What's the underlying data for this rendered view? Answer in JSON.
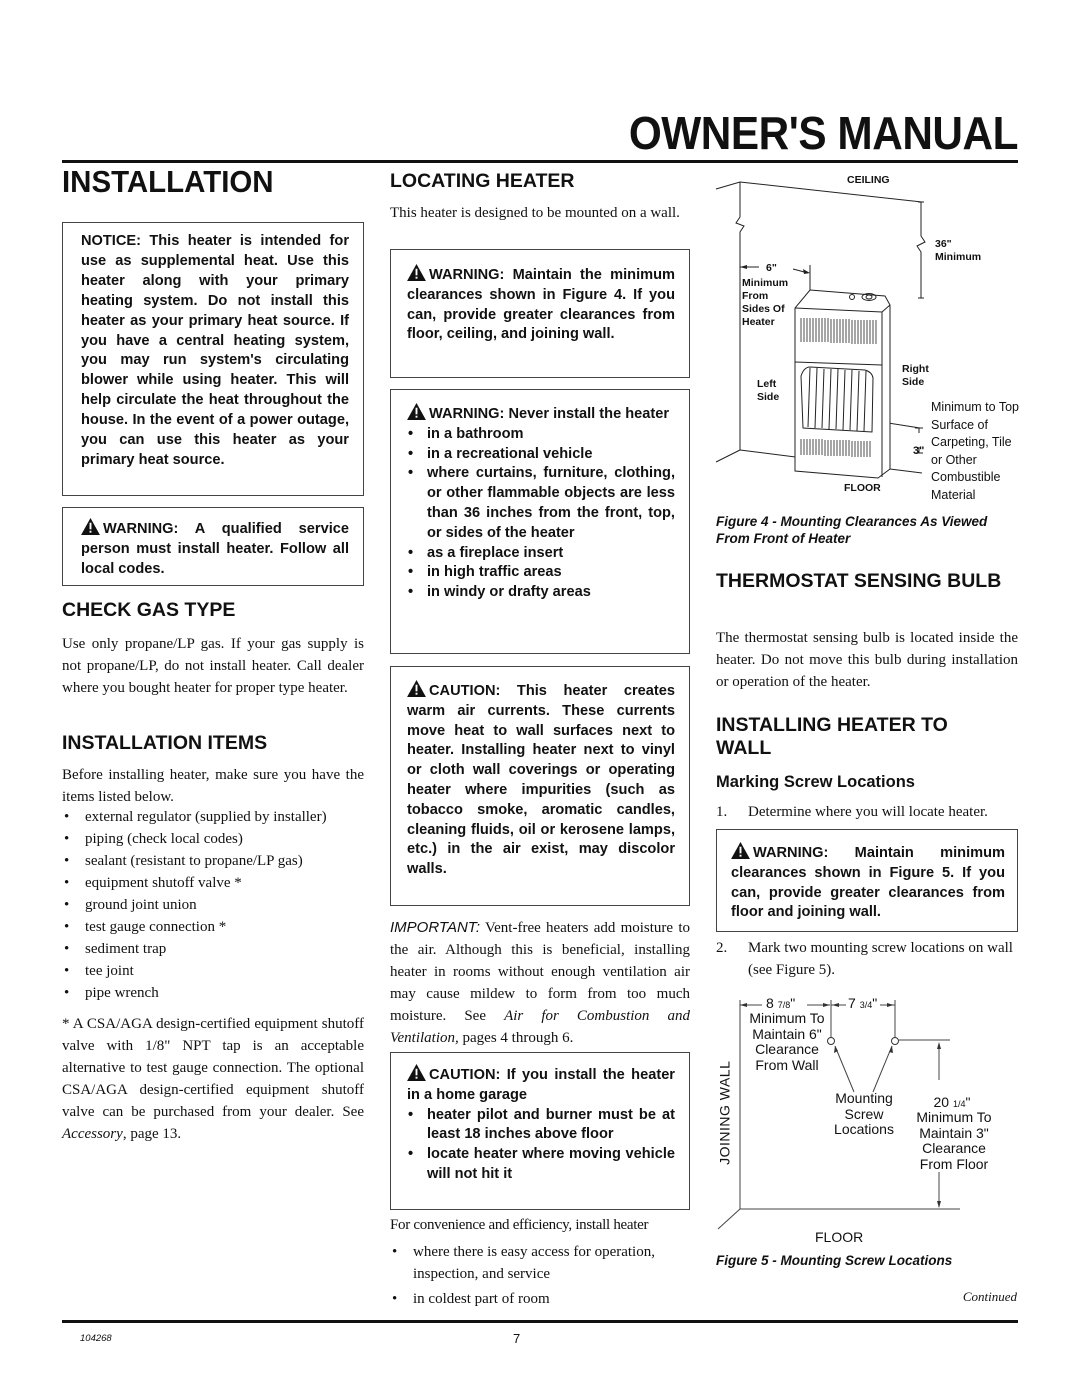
{
  "header": {
    "manual_title": "OWNER'S MANUAL",
    "section_title": "INSTALLATION"
  },
  "left_column": {
    "notice_box": "NOTICE: This heater is intended for use as supplemental heat. Use this heater along with your primary heating system. Do not install this heater as your primary heat source. If you have a central heating system, you may run system's circulating blower while using heater. This will help circulate the heat throughout the house. In the event of a power outage, you can use this heater as your primary heat source.",
    "qualified_warning": "WARNING: A qualified service person must install heater. Follow all local codes.",
    "check_gas_type": {
      "heading": "CHECK GAS TYPE",
      "body": "Use only propane/LP gas. If your gas supply is not propane/LP, do not install heater. Call dealer where you bought heater for proper type heater."
    },
    "installation_items": {
      "heading": "INSTALLATION ITEMS",
      "intro": "Before installing heater, make sure you have the items listed below.",
      "items": [
        "external regulator (supplied by installer)",
        "piping (check local codes)",
        "sealant (resistant to propane/LP gas)",
        "equipment shutoff valve *",
        "ground joint union",
        "test gauge connection *",
        "sediment trap",
        "tee joint",
        "pipe wrench"
      ],
      "footnote_part1": "* A CSA/AGA design-certified equipment shutoff valve with 1/8\" NPT tap is an acceptable alternative to test gauge connection. The optional CSA/AGA design-certified equipment shutoff valve can be purchased from your dealer. See ",
      "footnote_link": "Accessory",
      "footnote_part2": ", page 13."
    }
  },
  "middle_column": {
    "locating_heater": {
      "heading": "LOCATING HEATER",
      "body": "This heater is designed to be mounted on a wall."
    },
    "clearance_warning": "WARNING: Maintain the minimum clearances shown in Figure 4. If you can, provide greater clearances from floor, ceiling, and joining wall.",
    "never_install_warning": {
      "title": "WARNING: Never install the heater",
      "items": [
        "in a bathroom",
        "in a recreational vehicle",
        "where curtains, furniture, clothing, or other flammable objects are less than 36 inches from the front, top, or sides of the heater",
        "as a fireplace insert",
        "in high traffic areas",
        "in windy or drafty areas"
      ]
    },
    "air_currents_caution": "CAUTION: This heater creates warm air currents. These currents move heat to wall surfaces next to heater. Installing heater next to vinyl or cloth wall coverings or operating heater where impurities (such as tobacco smoke, aromatic candles, cleaning fluids, oil or kerosene lamps, etc.) in the air exist, may discolor walls.",
    "important": {
      "label": "IMPORTANT:",
      "text1": " Vent-free heaters add moisture to the air. Although this is beneficial, installing heater in rooms without enough ventilation air may cause mildew to form from too much moisture. See ",
      "link": "Air for Combustion and Ventilation,",
      "text2": " pages 4 through 6."
    },
    "garage_caution": {
      "title": "CAUTION: If you install the heater in a home garage",
      "items": [
        "heater pilot and burner must be at least 18 inches above floor",
        "locate heater where moving vehicle will not hit it"
      ]
    },
    "convenience": {
      "intro": "For convenience and efficiency, install heater",
      "items": [
        "where there is easy access for operation, inspection, and service",
        "in coldest part of room"
      ]
    }
  },
  "right_column": {
    "figure4": {
      "ceiling": "CEILING",
      "top_clearance_value": "36\"",
      "top_clearance_label": "Minimum",
      "side_clearance_value": "6\"",
      "side_clearance_label": "Minimum From Sides Of Heater",
      "left_side": "Left Side",
      "right_side": "Right Side",
      "floor_clearance_value": "3\"",
      "floor_clearance_label": "Minimum to Top Surface of Carpeting, Tile or Other Combustible Material",
      "floor": "FLOOR",
      "caption": "Figure 4 - Mounting Clearances As Viewed From Front of Heater"
    },
    "thermostat": {
      "heading": "THERMOSTAT SENSING BULB",
      "body": "The thermostat sensing bulb is located inside the heater. Do not move this bulb during installation or operation of the heater."
    },
    "installing_to_wall": {
      "heading": "INSTALLING HEATER TO WALL",
      "subheading": "Marking Screw Locations",
      "step1_num": "1.",
      "step1": "Determine where you will locate heater.",
      "warning": "WARNING: Maintain minimum clearances shown in Figure 5. If you can, provide greater clearances from floor and joining wall.",
      "step2_num": "2.",
      "step2": "Mark two mounting screw locations on wall (see Figure 5)."
    },
    "figure5": {
      "wall_offset_whole": "8",
      "wall_offset_frac": "7/8",
      "wall_offset_note": "Minimum To Maintain 6\" Clearance From Wall",
      "screw_spacing_whole": "7",
      "screw_spacing_frac": "3/4",
      "screw_label": "Mounting Screw Locations",
      "floor_offset_whole": "20",
      "floor_offset_frac": "1/4",
      "floor_offset_note": "Minimum To Maintain 3\" Clearance From Floor",
      "joining_wall": "JOINING WALL",
      "floor": "FLOOR",
      "caption": "Figure 5 - Mounting Screw Locations"
    },
    "continued": "Continued"
  },
  "footer": {
    "doc_number": "104268",
    "page_number": "7"
  }
}
